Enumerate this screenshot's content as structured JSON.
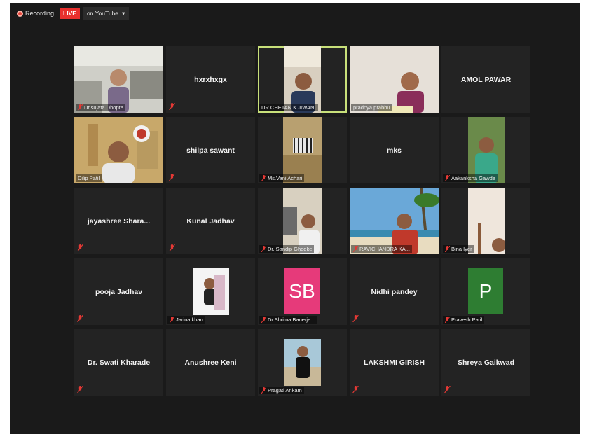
{
  "topbar": {
    "recording_label": "Recording",
    "live_label": "LIVE",
    "stream_label": "on YouTube"
  },
  "colors": {
    "sb_avatar": "#e63a7a",
    "p_avatar": "#2e7d32",
    "active_speaker": "#c8e07a",
    "mic_muted": "#e53935"
  },
  "participants": [
    {
      "name": "Dr.sujata Dhopte"
    },
    {
      "name": "hxrxhxgx"
    },
    {
      "name": "DR.CHETAN K JIWANI"
    },
    {
      "name": "pradnya prabhu"
    },
    {
      "name": "AMOL PAWAR"
    },
    {
      "name": "Dilip Patil"
    },
    {
      "name": "shilpa sawant"
    },
    {
      "name": "Ms.Vani Achari"
    },
    {
      "name": "mks"
    },
    {
      "name": "Aakanksha Gawde"
    },
    {
      "name": "jayashree  Shara..."
    },
    {
      "name": "Kunal Jadhav"
    },
    {
      "name": "Dr. Sandip Ghodke"
    },
    {
      "name": "RAVICHANDRA KA..."
    },
    {
      "name": "Bina Iyer"
    },
    {
      "name": "pooja Jadhav"
    },
    {
      "name": "Jarina khan"
    },
    {
      "name": "Dr.Shrima Banerje...",
      "initials": "SB"
    },
    {
      "name": "Nidhi pandey"
    },
    {
      "name": "Pravesh Patil",
      "initials": "P"
    },
    {
      "name": "Dr. Swati Kharade"
    },
    {
      "name": "Anushree Keni"
    },
    {
      "name": "Pragati Ankam"
    },
    {
      "name": "LAKSHMI GIRISH"
    },
    {
      "name": "Shreya Gaikwad"
    }
  ]
}
